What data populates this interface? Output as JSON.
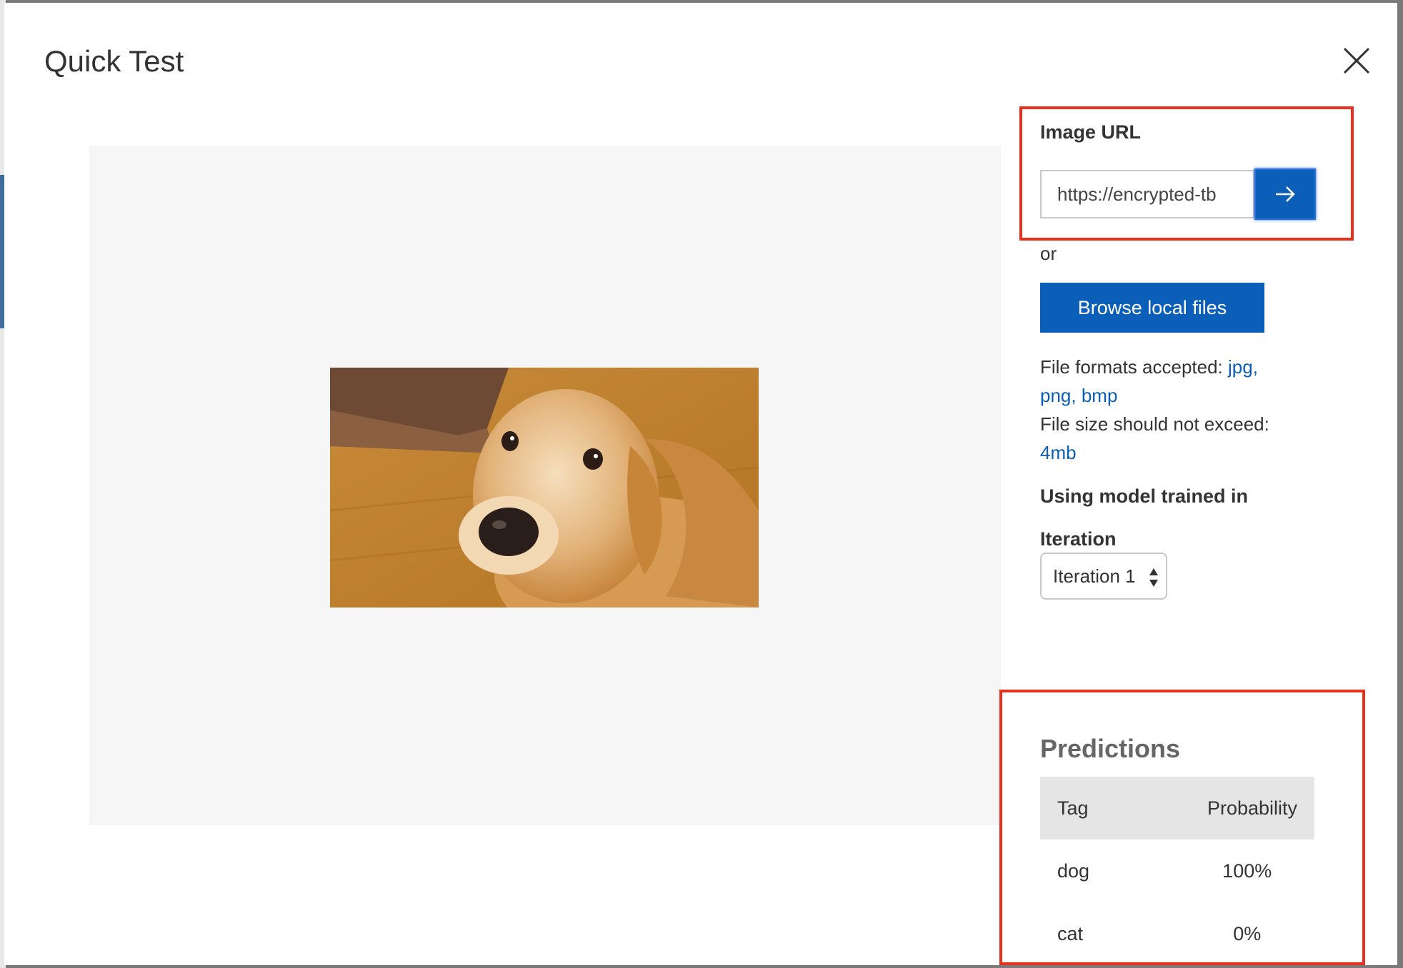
{
  "dialog": {
    "title": "Quick Test",
    "close_icon": "close-icon"
  },
  "preview": {
    "image": "golden-retriever-photo"
  },
  "url_section": {
    "label": "Image URL",
    "input_value": "https://encrypted-tb",
    "submit_icon": "arrow-right-icon"
  },
  "or_text": "or",
  "browse_button": "Browse local files",
  "file_info": {
    "formats_prefix": "File formats accepted: ",
    "formats_value": "jpg, png, bmp",
    "size_prefix": "File size should not exceed: ",
    "size_value": "4mb"
  },
  "model": {
    "heading": "Using model trained in",
    "iteration_label": "Iteration",
    "iteration_selected": "Iteration 1"
  },
  "predictions": {
    "title": "Predictions",
    "columns": [
      "Tag",
      "Probability"
    ],
    "rows": [
      {
        "tag": "dog",
        "probability": "100%"
      },
      {
        "tag": "cat",
        "probability": "0%"
      }
    ]
  },
  "colors": {
    "accent": "#0b5fb8",
    "highlight": "#e8301f",
    "preview_bg": "#f6f6f6"
  }
}
